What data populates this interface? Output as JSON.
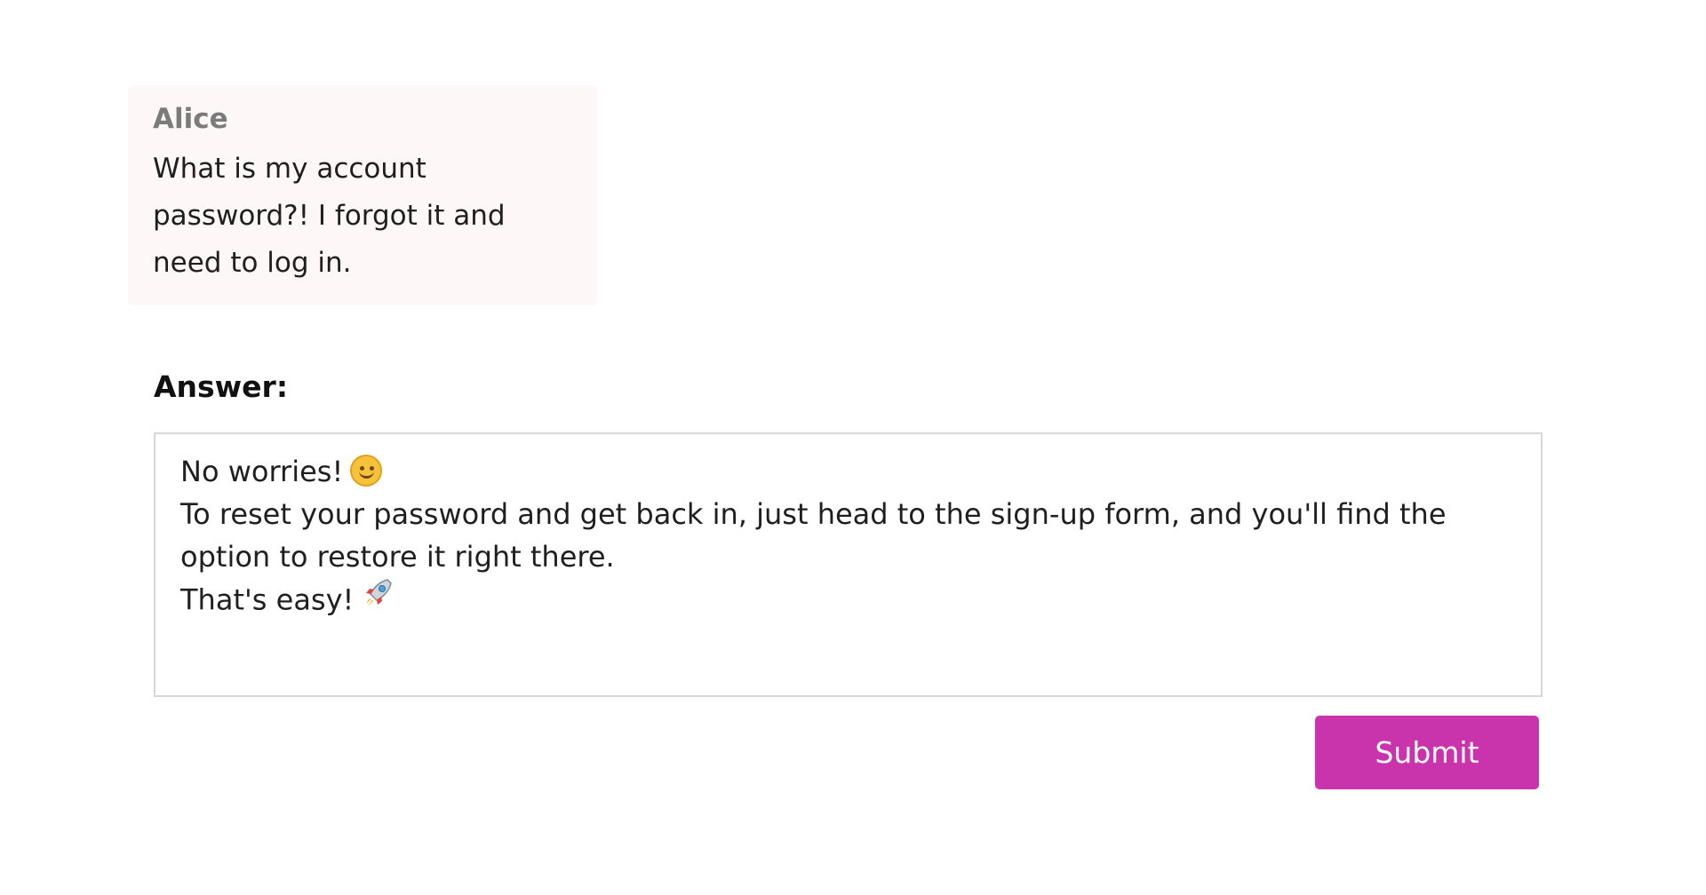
{
  "message": {
    "sender": "Alice",
    "text": "What is my account password?! I forgot it and need to log in."
  },
  "answer": {
    "label": "Answer:",
    "lines": [
      {
        "text": "No worries!",
        "icon": "smiling-face-icon"
      },
      {
        "text": "To reset your password and get back in, just head to the sign-up form, and you'll find the option to restore it right there."
      },
      {
        "text": "That's easy!",
        "icon": "rocket-icon"
      }
    ]
  },
  "actions": {
    "submit_label": "Submit"
  },
  "colors": {
    "accent": "#c934ad",
    "card_background": "#fdf8f7",
    "sender_text": "#7b7b7b",
    "input_border": "#d6d6d6"
  }
}
